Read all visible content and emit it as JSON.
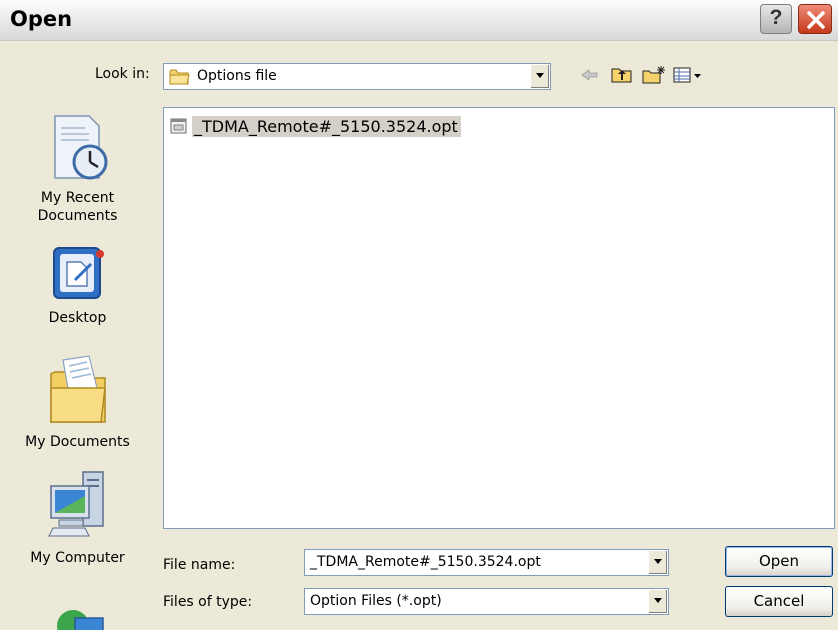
{
  "window": {
    "title": "Open"
  },
  "toolbar": {
    "look_in_label": "Look in:",
    "look_in_value": "Options file",
    "icons": [
      "back-arrow-icon",
      "up-folder-icon",
      "new-folder-icon",
      "views-menu-icon"
    ]
  },
  "places": [
    {
      "label_line1": "My Recent",
      "label_line2": "Documents",
      "icon": "recent-documents-icon"
    },
    {
      "label_line1": "Desktop",
      "label_line2": "",
      "icon": "desktop-icon"
    },
    {
      "label_line1": "My Documents",
      "label_line2": "",
      "icon": "my-documents-icon"
    },
    {
      "label_line1": "My Computer",
      "label_line2": "",
      "icon": "my-computer-icon"
    },
    {
      "label_line1": "",
      "label_line2": "",
      "icon": "network-places-icon"
    }
  ],
  "files": [
    {
      "name": "_TDMA_Remote#_5150.3524.opt",
      "icon": "option-file-icon",
      "selected": true
    }
  ],
  "bottom": {
    "file_name_label": "File name:",
    "file_name_value": "_TDMA_Remote#_5150.3524.opt",
    "file_type_label": "Files of type:",
    "file_type_value": "Option Files (*.opt)",
    "open_button": "Open",
    "cancel_button": "Cancel"
  },
  "colors": {
    "dialog_bg": "#ece9d8",
    "selection": "#d4d0c8",
    "close_button": "#c4391b"
  }
}
